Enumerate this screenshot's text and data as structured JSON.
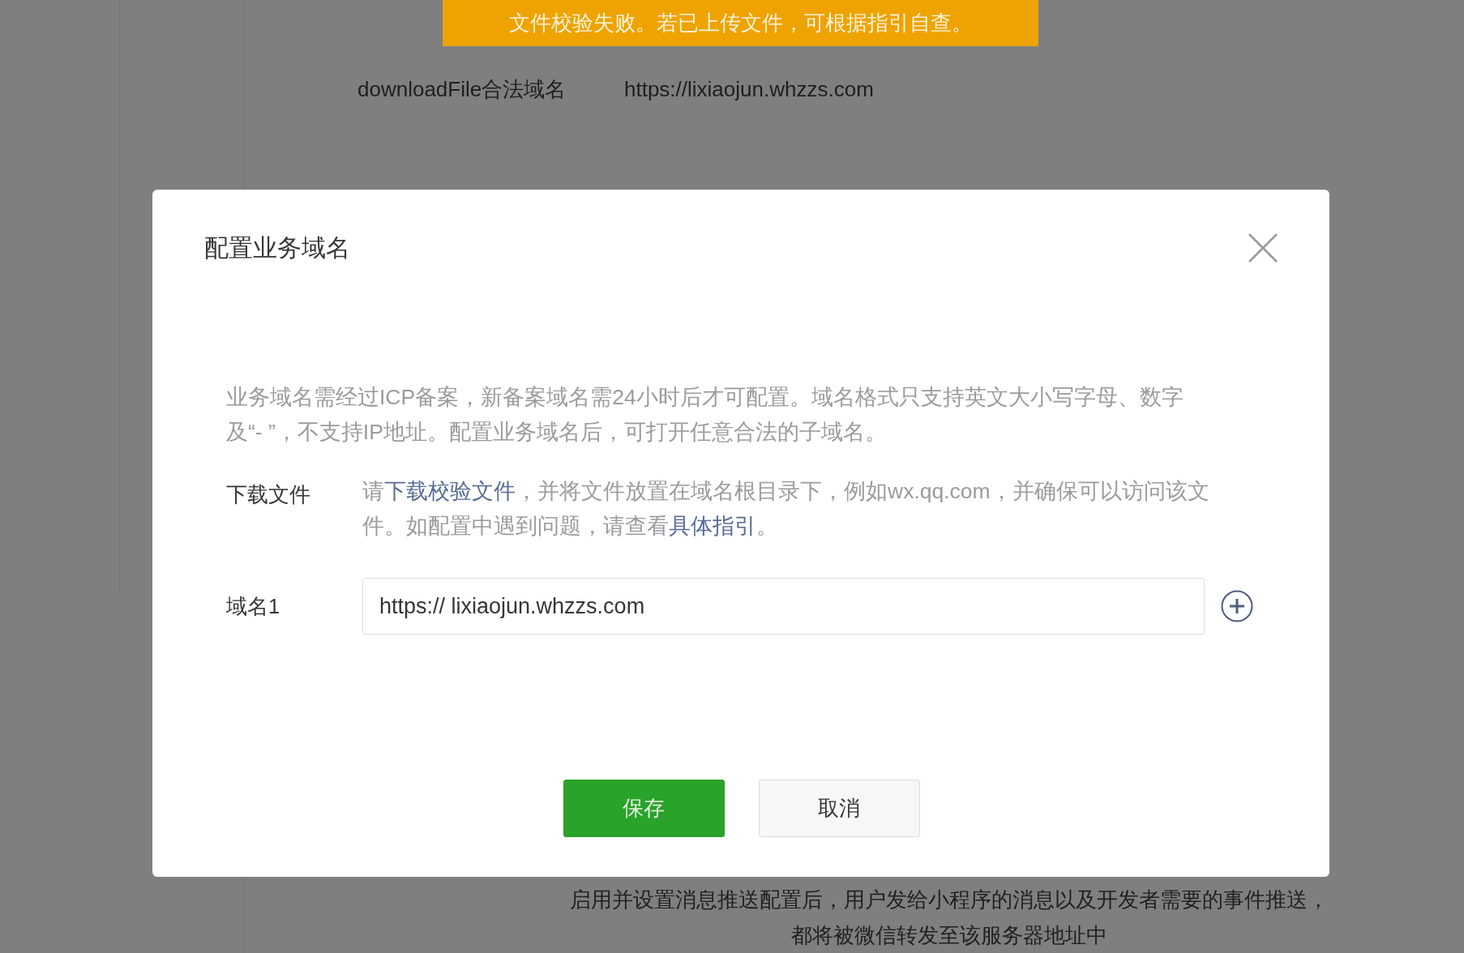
{
  "background": {
    "banner": "文件校验失败。若已上传文件，可根据指引自查。",
    "settings": [
      {
        "label": "downloadFile合法域名",
        "value": "https://lixiaojun.whzzs.com"
      }
    ],
    "push_note": "启用并设置消息推送配置后，用户发给小程序的消息以及开发者需要的事件推送，都将被微信转发至该服务器地址中"
  },
  "dialog": {
    "title": "配置业务域名",
    "intro": "业务域名需经过ICP备案，新备案域名需24小时后才可配置。域名格式只支持英文大小写字母、数字及“- ”，不支持IP地址。配置业务域名后，可打开任意合法的子域名。",
    "download": {
      "label": "下载文件",
      "segments": [
        {
          "kind": "text",
          "text": "请"
        },
        {
          "kind": "link",
          "text": "下载校验文件"
        },
        {
          "kind": "text",
          "text": "，并将文件放置在域名根目录下，例如wx.qq.com，并确保可以访问该文件。如配置中遇到问题，请查看"
        },
        {
          "kind": "link",
          "text": "具体指引"
        },
        {
          "kind": "text",
          "text": "。"
        }
      ]
    },
    "domains": [
      {
        "label": "域名1",
        "value": "https:// lixiaojun.whzzs.com"
      }
    ],
    "buttons": [
      {
        "kind": "primary",
        "label": "保存"
      },
      {
        "kind": "default",
        "label": "取消"
      }
    ]
  }
}
